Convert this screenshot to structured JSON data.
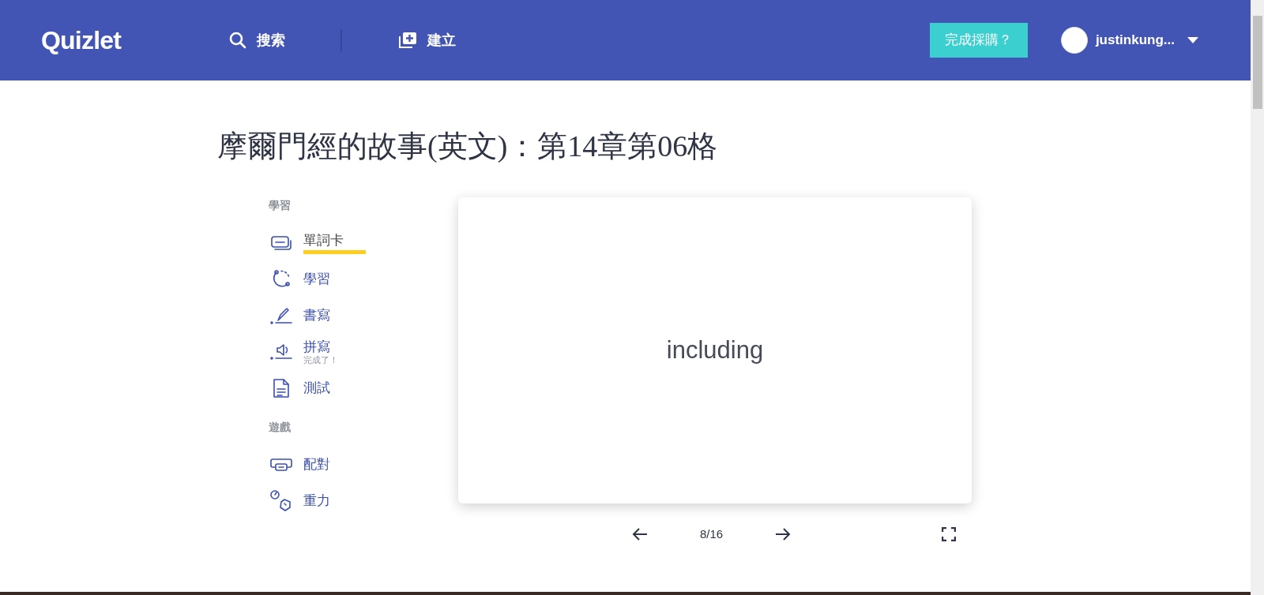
{
  "header": {
    "logo": "Quizlet",
    "search_label": "搜索",
    "create_label": "建立",
    "upgrade_button": "完成採購？",
    "username": "justinkung..."
  },
  "title": "摩爾門經的故事(英文)：第14章第06格",
  "sidebar": {
    "sections": [
      {
        "heading": "學習",
        "items": [
          {
            "kind": "flashcards",
            "label": "單詞卡",
            "selected": true
          },
          {
            "kind": "learn",
            "label": "學習",
            "selected": false
          },
          {
            "kind": "write",
            "label": "書寫",
            "selected": false
          },
          {
            "kind": "spell",
            "label": "拼寫",
            "note": "完成了！",
            "selected": false
          },
          {
            "kind": "test",
            "label": "測試",
            "selected": false
          }
        ]
      },
      {
        "heading": "遊戲",
        "items": [
          {
            "kind": "match",
            "label": "配對",
            "selected": false
          },
          {
            "kind": "gravity",
            "label": "重力",
            "selected": false
          }
        ]
      }
    ]
  },
  "card": {
    "term": "including"
  },
  "navigation": {
    "counter": "8/16"
  }
}
